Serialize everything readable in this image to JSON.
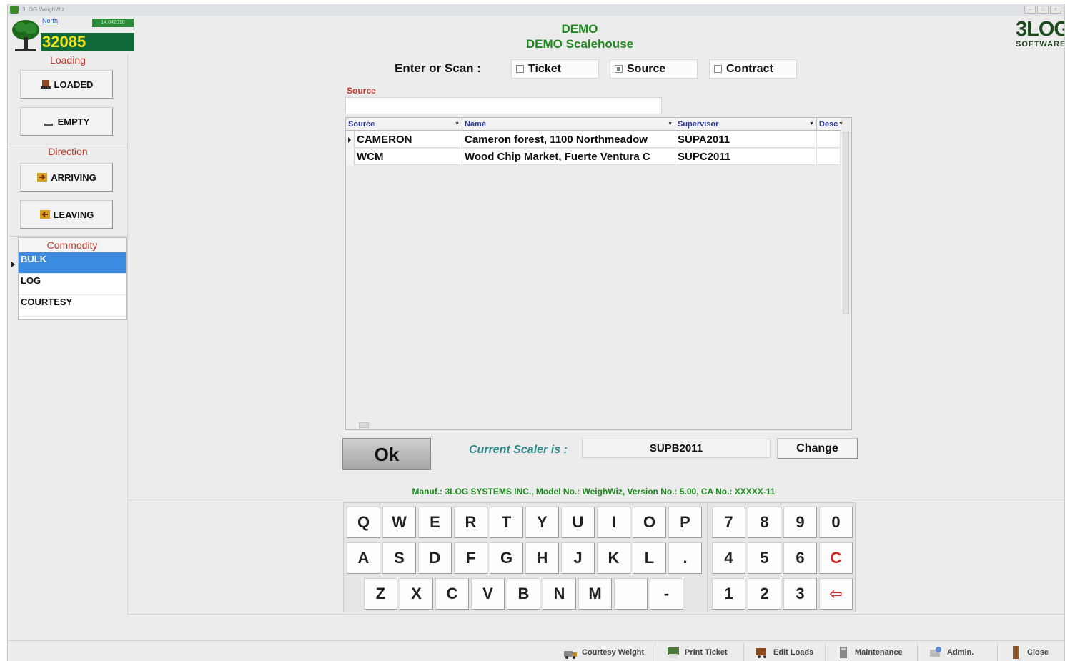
{
  "window": {
    "title": "3LOG WeighWiz",
    "controls": [
      "min",
      "max",
      "close"
    ]
  },
  "header": {
    "north_link": "North",
    "date_badge": "14.042010",
    "counter": "32085",
    "title_line1": "DEMO",
    "title_line2": "DEMO Scalehouse",
    "logo_line1": "3LOG",
    "logo_line2": "SOFTWARE"
  },
  "left": {
    "loading_label": "Loading",
    "loaded_btn": "LOADED",
    "empty_btn": "EMPTY",
    "direction_label": "Direction",
    "arriving_btn": "ARRIVING",
    "leaving_btn": "LEAVING",
    "commodity_label": "Commodity",
    "commodities": [
      "BULK",
      "LOG",
      "COURTESY"
    ],
    "selected_commodity": "BULK"
  },
  "scan": {
    "label": "Enter or Scan :",
    "options": [
      {
        "label": "Ticket",
        "checked": false
      },
      {
        "label": "Source",
        "checked": true
      },
      {
        "label": "Contract",
        "checked": false
      }
    ],
    "source_field_label": "Source",
    "source_value": ""
  },
  "grid": {
    "columns": [
      "Source",
      "Name",
      "Supervisor",
      "Desc"
    ],
    "rows": [
      {
        "source": "CAMERON",
        "name": "Cameron forest, 1100 Northmeadow",
        "supervisor": "SUPA2011",
        "desc": ""
      },
      {
        "source": "WCM",
        "name": "Wood Chip Market, Fuerte Ventura C",
        "supervisor": "SUPC2011",
        "desc": ""
      }
    ]
  },
  "actions": {
    "ok": "Ok",
    "current_scaler_label": "Current Scaler is :",
    "current_scaler": "SUPB2011",
    "change": "Change"
  },
  "manufacturer_line": "Manuf.: 3LOG SYSTEMS INC., Model No.: WeighWiz, Version No.: 5.00, CA No.: XXXXX-11",
  "keyboard": {
    "row1": [
      "Q",
      "W",
      "E",
      "R",
      "T",
      "Y",
      "U",
      "I",
      "O",
      "P"
    ],
    "row2": [
      "A",
      "S",
      "D",
      "F",
      "G",
      "H",
      "J",
      "K",
      "L",
      "."
    ],
    "row3": [
      "Z",
      "X",
      "C",
      "V",
      "B",
      "N",
      "M",
      " ",
      "-"
    ]
  },
  "numpad": {
    "row1": [
      "7",
      "8",
      "9",
      "0"
    ],
    "row2": [
      "4",
      "5",
      "6",
      "C"
    ],
    "row3": [
      "1",
      "2",
      "3",
      "⇦"
    ]
  },
  "bottom_bar": {
    "courtesy_weight": "Courtesy Weight",
    "print_ticket": "Print Ticket",
    "edit_loads": "Edit Loads",
    "maintenance": "Maintenance",
    "admin": "Admin.",
    "close": "Close"
  },
  "colors": {
    "accent_green": "#1e8a1e",
    "label_red": "#c0392b",
    "selection_blue": "#3b8be0",
    "counter_bg": "#0f6a38",
    "counter_fg": "#f3e31a"
  }
}
